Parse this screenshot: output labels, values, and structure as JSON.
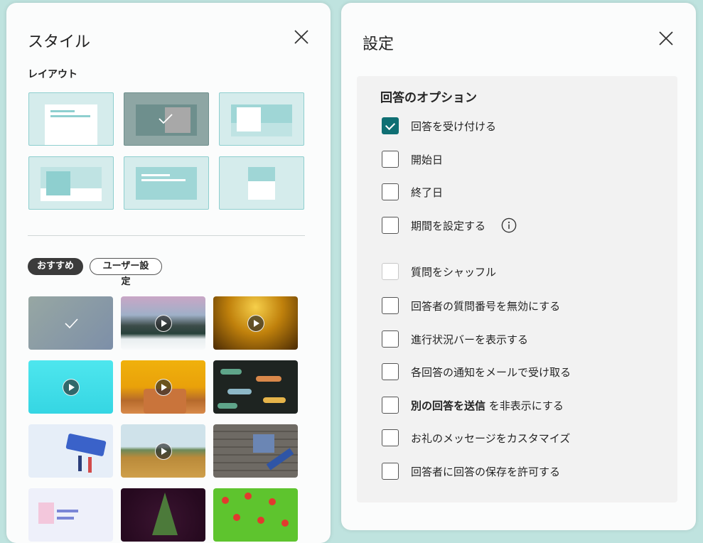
{
  "style_panel": {
    "title": "スタイル",
    "layout_label": "レイアウト",
    "tabs": [
      {
        "label": "おすすめ",
        "active": true
      },
      {
        "label": "ユーザー設定",
        "active": false
      }
    ],
    "themes": [
      {
        "name": "theme-gray-gradient",
        "selected": true,
        "video": false
      },
      {
        "name": "theme-snowy-mountains",
        "selected": false,
        "video": true
      },
      {
        "name": "theme-golden-sparkles",
        "selected": false,
        "video": true
      },
      {
        "name": "theme-cyan",
        "selected": false,
        "video": true
      },
      {
        "name": "theme-birthday-cake",
        "selected": false,
        "video": true
      },
      {
        "name": "theme-dinosaurs",
        "selected": false,
        "video": false
      },
      {
        "name": "theme-rating-illustration",
        "selected": false,
        "video": false
      },
      {
        "name": "theme-wind-turbines",
        "selected": false,
        "video": true
      },
      {
        "name": "theme-gift-wood",
        "selected": false,
        "video": false
      },
      {
        "name": "theme-form-illustration",
        "selected": false,
        "video": false
      },
      {
        "name": "theme-christmas-tree",
        "selected": false,
        "video": false
      },
      {
        "name": "theme-tomatoes",
        "selected": false,
        "video": false
      }
    ]
  },
  "settings_panel": {
    "title": "設定",
    "section_heading": "回答のオプション",
    "options": [
      {
        "label": "回答を受け付ける",
        "checked": true
      },
      {
        "label": "開始日",
        "checked": false
      },
      {
        "label": "終了日",
        "checked": false
      },
      {
        "label": "期間を設定する",
        "checked": false,
        "info": true
      },
      {
        "label": "質問をシャッフル",
        "checked": false,
        "disabled": true
      },
      {
        "label": "回答者の質問番号を無効にする",
        "checked": false
      },
      {
        "label": "進行状況バーを表示する",
        "checked": false
      },
      {
        "label": "各回答の通知をメールで受け取る",
        "checked": false
      },
      {
        "label_bold": "別の回答を送信",
        "label_rest": " を非表示にする",
        "checked": false
      },
      {
        "label": "お礼のメッセージをカスタマイズ",
        "checked": false
      },
      {
        "label": "回答者に回答の保存を許可する",
        "checked": false
      }
    ]
  },
  "colors": {
    "accent": "#0f6f73",
    "background": "#bfe3df"
  }
}
